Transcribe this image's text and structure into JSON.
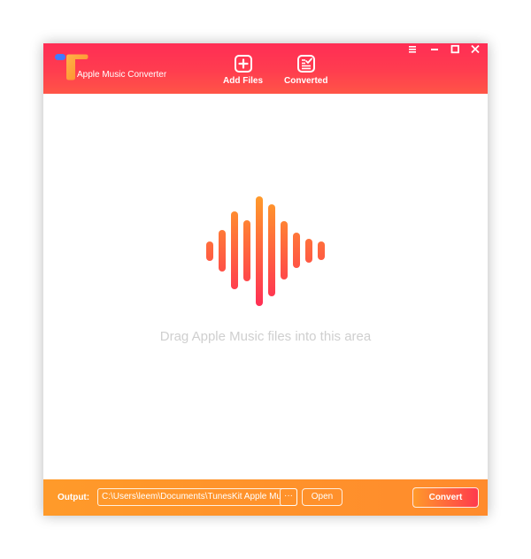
{
  "app": {
    "title": "Apple Music Converter"
  },
  "toolbar": {
    "add_files_label": "Add Files",
    "converted_label": "Converted"
  },
  "window_controls": {
    "menu_icon": "hamburger-menu-icon",
    "minimize_icon": "minimize-icon",
    "maximize_icon": "maximize-icon",
    "close_icon": "close-icon"
  },
  "drop_area": {
    "icon": "sound-wave-icon",
    "hint": "Drag Apple Music files into this area"
  },
  "footer": {
    "output_label": "Output:",
    "output_path": "C:\\Users\\leem\\Documents\\TunesKit Apple Music Converter\\Converted",
    "browse_label": "···",
    "open_label": "Open",
    "convert_label": "Convert"
  },
  "colors": {
    "header_top": "#ff2d55",
    "header_bottom": "#ff5547",
    "footer": "#ff9a2a",
    "wave_top": "#ff9a2a",
    "wave_bottom": "#ff2d55",
    "logo_blue": "#3f7bff",
    "logo_orange": "#ffa53a",
    "hint_text": "#cfcfcf"
  }
}
